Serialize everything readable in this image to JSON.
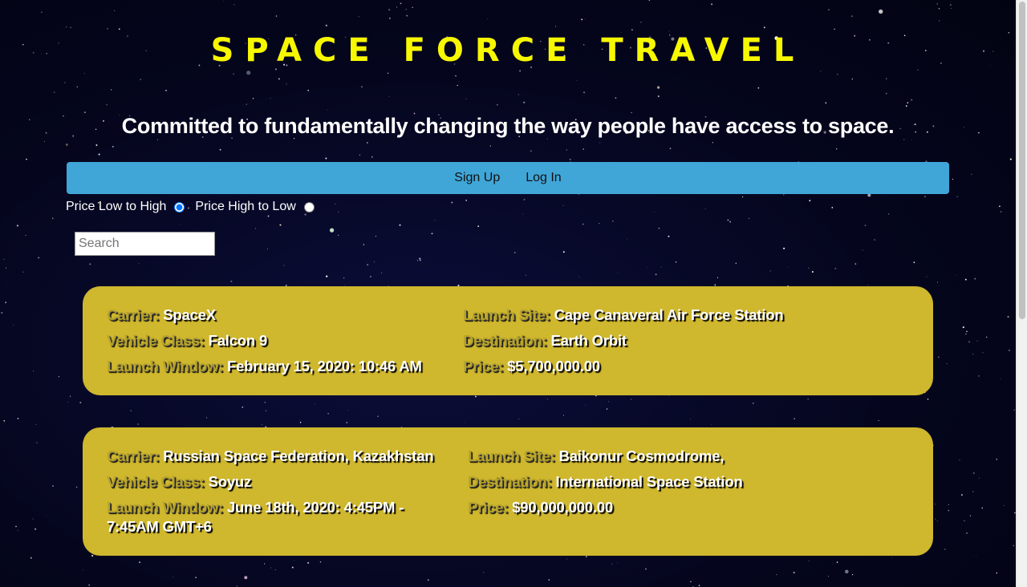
{
  "site": {
    "title": "SPACE FORCE TRAVEL",
    "tagline": "Committed to fundamentally changing the way people have access to space."
  },
  "nav": {
    "sign_up": "Sign Up",
    "log_in": "Log In"
  },
  "sort": {
    "low_to_high": "Price Low to High",
    "high_to_low": "Price High to Low",
    "selected": "low_to_high"
  },
  "search": {
    "placeholder": "Search",
    "value": ""
  },
  "labels": {
    "carrier": "Carrier:",
    "vehicle_class": "Vehicle Class:",
    "launch_window": "Launch Window:",
    "launch_site": "Launch Site:",
    "destination": "Destination:",
    "price": "Price:"
  },
  "flights": [
    {
      "carrier": "SpaceX",
      "vehicle_class": "Falcon 9",
      "launch_window": "February 15, 2020: 10:46 AM",
      "launch_site": "Cape Canaveral Air Force Station",
      "destination": "Earth Orbit",
      "price": "$5,700,000.00"
    },
    {
      "carrier": "Russian Space Federation, Kazakhstan",
      "vehicle_class": "Soyuz",
      "launch_window": "June 18th, 2020: 4:45PM - 7:45AM GMT+6",
      "launch_site": "Baikonur Cosmodrome,",
      "destination": "International Space Station",
      "price": "$90,000,000.00"
    }
  ],
  "colors": {
    "title": "#f7f700",
    "navbar": "#40a6d8",
    "card": "#cfb72e",
    "background": "#05061e"
  }
}
